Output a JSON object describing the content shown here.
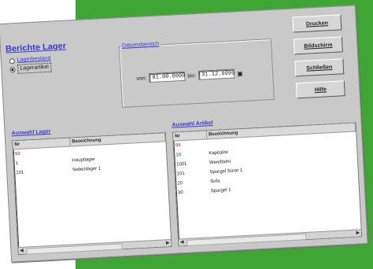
{
  "window": {
    "title": "Berichte Lager"
  },
  "report_type": {
    "options": [
      {
        "label": "Lagerbestand",
        "selected": false
      },
      {
        "label": "Lagerartikel",
        "selected": true
      }
    ]
  },
  "date_range": {
    "title": "Datumsbereich",
    "from_label": "von:",
    "from_value": "01.00.0000",
    "to_label": "bis:",
    "to_value": "31.12.9999"
  },
  "buttons": {
    "print": "Drucken",
    "preview": "Bildschirm",
    "close": "Schließen",
    "help": "Hilfe"
  },
  "lager_list": {
    "title": "Auswahl Lager",
    "columns": [
      "Nr",
      "Bezeichnung"
    ],
    "rows": [
      {
        "nr": "99",
        "name": "",
        "selected": true
      },
      {
        "nr": "1",
        "name": "Hauptlager",
        "selected": false
      },
      {
        "nr": "101",
        "name": "Nebenlager 1",
        "selected": false
      }
    ]
  },
  "artikel_list": {
    "title": "Auswahl Artikel",
    "columns": [
      "Nr",
      "Bezeichnung"
    ],
    "rows": [
      {
        "nr": "99",
        "name": "",
        "selected": true
      },
      {
        "nr": "10",
        "name": "Kapitalist",
        "selected": false
      },
      {
        "nr": "1001",
        "name": "Wendbohr",
        "selected": false
      },
      {
        "nr": "101",
        "name": "Spargel Sorte 1",
        "selected": false
      },
      {
        "nr": "20",
        "name": "Sofa",
        "selected": false
      },
      {
        "nr": "30",
        "name": "Spargel 1",
        "selected": false
      }
    ]
  }
}
